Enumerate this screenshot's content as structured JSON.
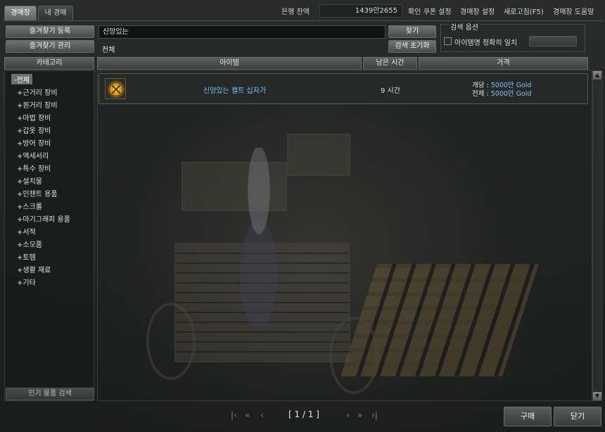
{
  "tabs": [
    {
      "label": "경매장",
      "active": true
    },
    {
      "label": "내 경매",
      "active": false
    }
  ],
  "top": {
    "bank_label": "은행 잔액",
    "bank_balance": "1439만2655",
    "coupon": "확인 쿠폰 설정",
    "settings": "경매장 설정",
    "refresh": "새로고침(F5)",
    "help": "경매장 도움말"
  },
  "left_buttons": {
    "favorite_register": "즐겨찾기 등록",
    "favorite_manage": "즐겨찾기 관리"
  },
  "search": {
    "query": "신망있는",
    "category_value": "전체",
    "find_button": "찾기",
    "reset_button": "검색 초기화"
  },
  "options": {
    "title": "검색 옵션",
    "exact_match_label": "아이템명 정확히 일치",
    "exact_match_checked": false
  },
  "headers": {
    "category": "카테고리",
    "item": "아이템",
    "time_left": "남은 시간",
    "price": "가격"
  },
  "categories": [
    "-전체",
    "+근거리 장비",
    "+원거리 장비",
    "+마법 장비",
    "+갑옷 장비",
    "+방어 장비",
    "+액세서리",
    "+특수 장비",
    "+설치물",
    "+인챈트 용품",
    "+스크롤",
    "+마기그래피 용품",
    "+서적",
    "+소모품",
    "+토템",
    "+생활 재료",
    "+기타"
  ],
  "popular_search": "인기 물품 검색",
  "listings": [
    {
      "name": "신망있는 켈트 십자가",
      "time_left": "9 시간",
      "unit_label": "개당 : ",
      "unit_price": "5000만 Gold",
      "total_label": "전체 : ",
      "total_price": "5000만 Gold",
      "icon": "celtic-cross-icon"
    }
  ],
  "pagination": {
    "first": "|‹",
    "prev_block": "«",
    "prev": "‹",
    "page_text": "[ 1 / 1 ]",
    "next": "›",
    "next_block": "»",
    "last": "›|"
  },
  "bottom_buttons": {
    "buy": "구매",
    "close": "닫기"
  },
  "colors": {
    "price_value": "#79c2f0",
    "item_name": "#79c2f0"
  }
}
